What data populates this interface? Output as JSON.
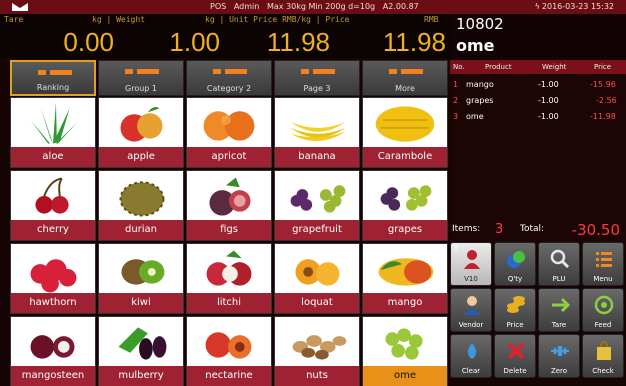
{
  "status": {
    "center": "POS   Admin   Max 30kg Min 200g d=10g   A2.00.87",
    "datetime": "2016-03-23 15:32"
  },
  "scale": {
    "tare_label": "Tare",
    "weight_label": "kg | Weight",
    "unit_price_label": "kg | Unit Price  RMB/kg | Price",
    "rmb_label": "RMB",
    "tare": "0.00",
    "weight": "1.00",
    "unit_price": "11.98",
    "price": "11.98"
  },
  "order": {
    "number": "10802",
    "current_item": "ome",
    "headers": {
      "no": "No.",
      "product": "Product",
      "weight": "Weight",
      "price": "Price"
    },
    "rows": [
      {
        "no": "1",
        "product": "mango",
        "weight": "-1.00",
        "price": "-15.96"
      },
      {
        "no": "2",
        "product": "grapes",
        "weight": "-1.00",
        "price": "-2.56"
      },
      {
        "no": "3",
        "product": "ome",
        "weight": "-1.00",
        "price": "-11.98"
      }
    ],
    "items_label": "Items:",
    "items_count": "3",
    "total_label": "Total:",
    "total": "-30.50"
  },
  "tabs": [
    "Ranking",
    "Group 1",
    "Category 2",
    "Page 3",
    "More"
  ],
  "products": [
    "aloe",
    "apple",
    "apricot",
    "banana",
    "Carambole",
    "cherry",
    "durian",
    "figs",
    "grapefruit",
    "grapes",
    "hawthorn",
    "kiwi",
    "litchi",
    "loquat",
    "mango",
    "mangosteen",
    "mulberry",
    "nectarine",
    "nuts",
    "ome"
  ],
  "functions": {
    "badge": "3",
    "labels": [
      "V10",
      "Q'ty",
      "PLU",
      "Menu",
      "Vendor",
      "Price",
      "Tare",
      "Feed",
      "Clear",
      "Delete",
      "Zero",
      "Check"
    ]
  },
  "colors": {
    "accent": "#e89018",
    "product_bar": "#9e2232",
    "status_bar": "#6a0e14",
    "readout": "#f0b020",
    "negative": "#ff3b3b"
  }
}
